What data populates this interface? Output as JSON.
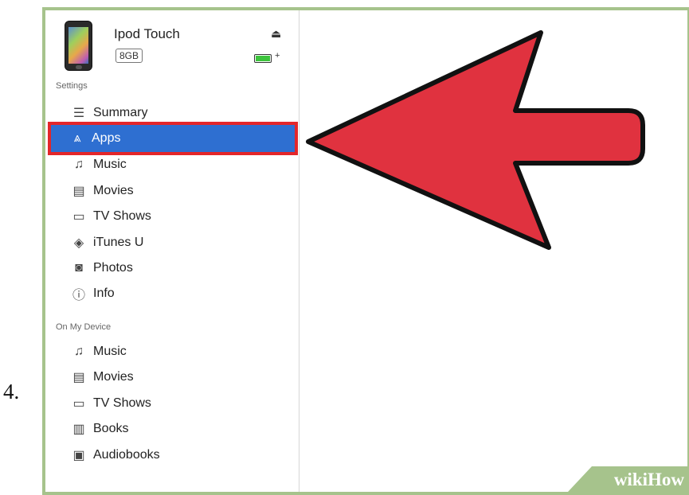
{
  "step": {
    "number": "4."
  },
  "device": {
    "name": "Ipod Touch",
    "capacity": "8GB",
    "battery_level": 1.0,
    "eject_icon": "eject-icon",
    "battery_icon": "battery-charging-icon"
  },
  "sidebar": {
    "settings_header": "Settings",
    "settings_items": [
      {
        "label": "Summary",
        "icon": "summary-icon"
      },
      {
        "label": "Apps",
        "icon": "apps-icon",
        "selected": true
      },
      {
        "label": "Music",
        "icon": "music-note-icon"
      },
      {
        "label": "Movies",
        "icon": "film-icon"
      },
      {
        "label": "TV Shows",
        "icon": "tv-icon"
      },
      {
        "label": "iTunes U",
        "icon": "graduation-cap-icon"
      },
      {
        "label": "Photos",
        "icon": "camera-icon"
      },
      {
        "label": "Info",
        "icon": "info-icon"
      }
    ],
    "device_header": "On My Device",
    "device_items": [
      {
        "label": "Music",
        "icon": "music-note-icon"
      },
      {
        "label": "Movies",
        "icon": "film-icon"
      },
      {
        "label": "TV Shows",
        "icon": "tv-icon"
      },
      {
        "label": "Books",
        "icon": "book-icon"
      },
      {
        "label": "Audiobooks",
        "icon": "audiobook-icon"
      }
    ]
  },
  "colors": {
    "selection": "#2e6fd1",
    "highlight_border": "#e3262a",
    "arrow_fill": "#e0323f",
    "frame": "#a6c38c"
  },
  "watermark": {
    "wiki": "wiki",
    "how": "How"
  }
}
